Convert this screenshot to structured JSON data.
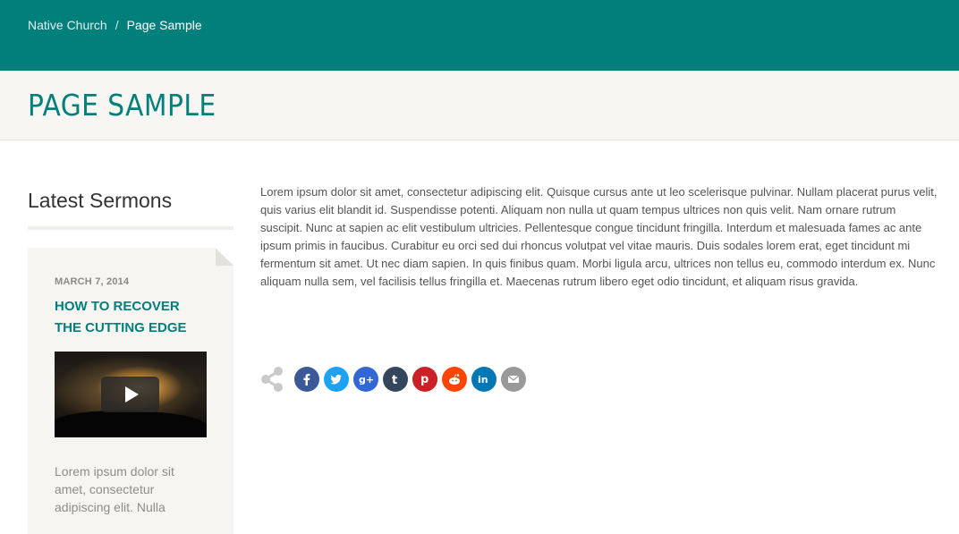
{
  "breadcrumb": {
    "home": "Native Church",
    "separator": "/",
    "current": "Page Sample"
  },
  "page": {
    "title": "PAGE SAMPLE"
  },
  "sidebar": {
    "widget_title": "Latest Sermons",
    "sermon": {
      "date": "MARCH 7, 2014",
      "title": "HOW TO RECOVER THE CUTTING EDGE",
      "video_icon": "play-icon",
      "excerpt": "Lorem ipsum dolor sit amet, consectetur adipiscing elit. Nulla"
    }
  },
  "content": {
    "body": "Lorem ipsum dolor sit amet, consectetur adipiscing elit. Quisque cursus ante ut leo scelerisque pulvinar. Nullam placerat purus velit, quis varius elit blandit id. Suspendisse potenti. Aliquam non nulla ut quam tempus ultrices non quis velit. Nam ornare rutrum suscipit. Nunc at sapien ac elit vestibulum ultricies. Pellentesque congue tincidunt fringilla. Interdum et malesuada fames ac ante ipsum primis in faucibus. Curabitur eu orci sed dui rhoncus volutpat vel vitae mauris. Duis sodales lorem erat, eget tincidunt mi fermentum sit amet. Ut nec diam sapien. In quis finibus quam. Morbi ligula arcu, ultrices non tellus eu, commodo interdum ex. Nunc aliquam nulla sem, vel facilisis tellus fringilla et. Maecenas rutrum libero eget odio tincidunt, et aliquam risus gravida."
  },
  "share": {
    "icon": "share-icon",
    "buttons": [
      {
        "name": "facebook",
        "glyph": "f",
        "color": "#3b5998"
      },
      {
        "name": "twitter",
        "glyph": "t",
        "color": "#1da1f2"
      },
      {
        "name": "google-plus",
        "glyph": "g+",
        "color": "#3367d6"
      },
      {
        "name": "tumblr",
        "glyph": "t",
        "color": "#35465c"
      },
      {
        "name": "pinterest",
        "glyph": "p",
        "color": "#cb2027"
      },
      {
        "name": "reddit",
        "glyph": "r",
        "color": "#ff4500"
      },
      {
        "name": "linkedin",
        "glyph": "in",
        "color": "#0077b5"
      },
      {
        "name": "email",
        "glyph": "mail",
        "color": "#999999"
      }
    ]
  },
  "colors": {
    "brand": "#007f7b",
    "title_bar_bg": "#f7f6f3",
    "card_bg": "#f6f5f2"
  }
}
